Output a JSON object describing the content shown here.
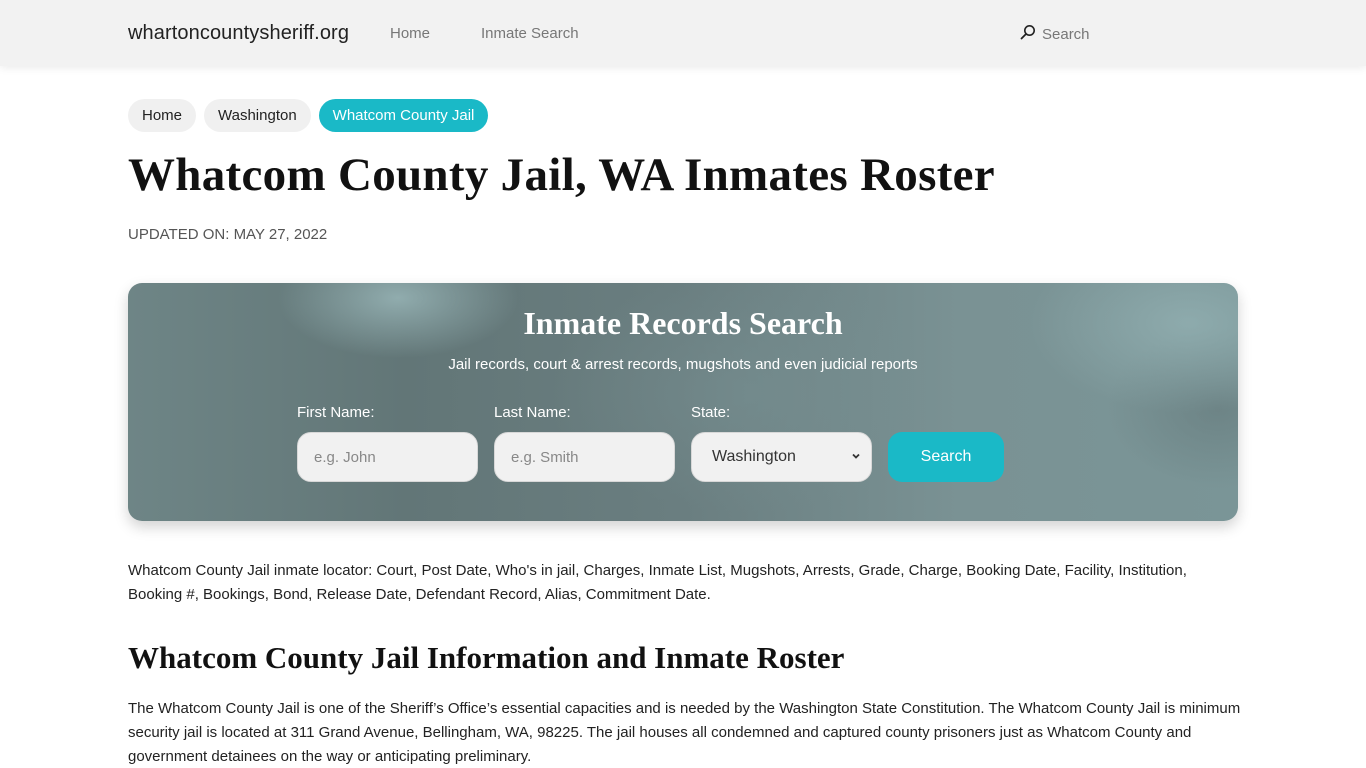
{
  "navbar": {
    "brand": "whartoncountysheriff.org",
    "links": [
      {
        "label": "Home"
      },
      {
        "label": "Inmate Search"
      }
    ],
    "search_label": "Search",
    "search_icon": "search-icon"
  },
  "breadcrumb": [
    {
      "label": "Home",
      "active": false
    },
    {
      "label": "Washington",
      "active": false
    },
    {
      "label": "Whatcom County Jail",
      "active": true
    }
  ],
  "page": {
    "title": "Whatcom County Jail, WA Inmates Roster",
    "updated": "UPDATED ON: MAY 27, 2022"
  },
  "search_card": {
    "title": "Inmate Records Search",
    "subtitle": "Jail records, court & arrest records, mugshots and even judicial reports",
    "first_name_label": "First Name:",
    "first_name_placeholder": "e.g. John",
    "first_name_value": "",
    "last_name_label": "Last Name:",
    "last_name_placeholder": "e.g. Smith",
    "last_name_value": "",
    "state_label": "State:",
    "state_selected": "Washington",
    "button_label": "Search"
  },
  "content": {
    "intro": "Whatcom County Jail inmate locator: Court, Post Date, Who's in jail, Charges, Inmate List, Mugshots, Arrests, Grade, Charge, Booking Date, Facility, Institution, Booking #, Bookings, Bond, Release Date, Defendant Record, Alias, Commitment Date.",
    "section_title": "Whatcom County Jail Information and Inmate Roster",
    "section_body": "The Whatcom County Jail is one of the Sheriff’s Office’s essential capacities and is needed by the Washington State Constitution. The Whatcom County Jail is minimum security jail is located at 311 Grand Avenue, Bellingham, WA, 98225. The jail houses all condemned and captured county prisoners just as Whatcom County and government detainees on the way or anticipating preliminary."
  },
  "colors": {
    "accent": "#1ab9c7",
    "navbar_bg": "#f2f2f2"
  }
}
